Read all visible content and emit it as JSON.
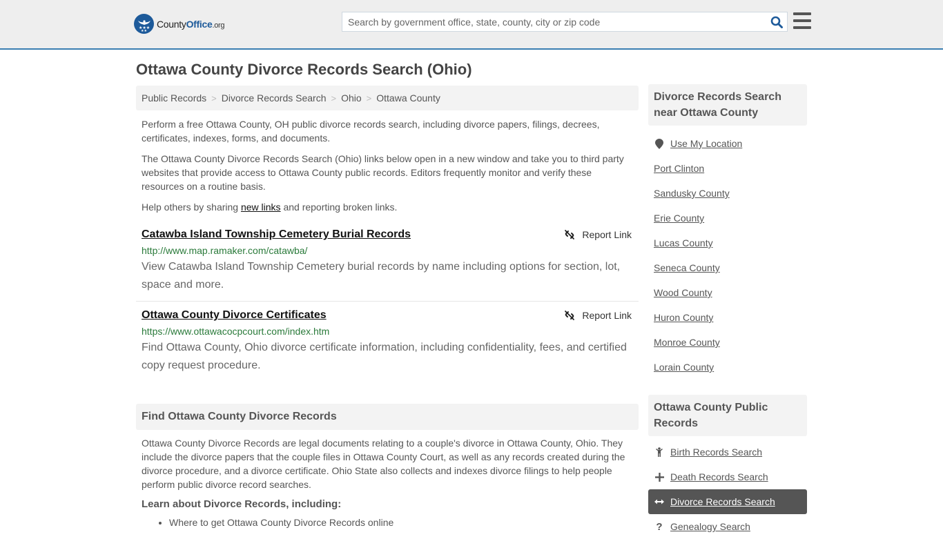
{
  "header": {
    "logo": {
      "county": "County",
      "office": "Office",
      "org": ".org"
    },
    "search": {
      "placeholder": "Search by government office, state, county, city or zip code",
      "value": ""
    },
    "brand_color": "#1d5a9a",
    "accent_border": "#3a7eb1"
  },
  "page": {
    "title": "Ottawa County Divorce Records Search (Ohio)"
  },
  "breadcrumb": [
    {
      "label": "Public Records"
    },
    {
      "label": "Divorce Records Search"
    },
    {
      "label": "Ohio"
    },
    {
      "label": "Ottawa County"
    }
  ],
  "breadcrumb_sep": ">",
  "intro": {
    "p1": "Perform a free Ottawa County, OH public divorce records search, including divorce papers, filings, decrees, certificates, indexes, forms, and documents.",
    "p2": "The Ottawa County Divorce Records Search (Ohio) links below open in a new window and take you to third party websites that provide access to Ottawa County public records. Editors frequently monitor and verify these resources on a routine basis.",
    "p3_before": "Help others by sharing ",
    "p3_link": "new links",
    "p3_after": " and reporting broken links."
  },
  "links": [
    {
      "title": "Catawba Island Township Cemetery Burial Records",
      "url": "http://www.map.ramaker.com/catawba/",
      "description": "View Catawba Island Township Cemetery burial records by name including options for section, lot, space and more.",
      "report_label": "Report Link"
    },
    {
      "title": "Ottawa County Divorce Certificates",
      "url": "https://www.ottawacocpcourt.com/index.htm",
      "description": "Find Ottawa County, Ohio divorce certificate information, including confidentiality, fees, and certified copy request procedure.",
      "report_label": "Report Link"
    }
  ],
  "find_section": {
    "heading": "Find Ottawa County Divorce Records",
    "body": "Ottawa County Divorce Records are legal documents relating to a couple's divorce in Ottawa County, Ohio. They include the divorce papers that the couple files in Ottawa County Court, as well as any records created during the divorce procedure, and a divorce certificate. Ohio State also collects and indexes divorce filings to help people perform public divorce record searches.",
    "learn_heading": "Learn about Divorce Records, including:",
    "bullets": [
      "Where to get Ottawa County Divorce Records online"
    ]
  },
  "sidebar": {
    "nearby": {
      "heading": "Divorce Records Search near Ottawa County",
      "use_location": "Use My Location",
      "items": [
        {
          "label": "Port Clinton"
        },
        {
          "label": "Sandusky County"
        },
        {
          "label": "Erie County"
        },
        {
          "label": "Lucas County"
        },
        {
          "label": "Seneca County"
        },
        {
          "label": "Wood County"
        },
        {
          "label": "Huron County"
        },
        {
          "label": "Monroe County"
        },
        {
          "label": "Lorain County"
        }
      ]
    },
    "public_records": {
      "heading": "Ottawa County Public Records",
      "items": [
        {
          "label": "Birth Records Search",
          "icon": "child-icon"
        },
        {
          "label": "Death Records Search",
          "icon": "plus-icon"
        },
        {
          "label": "Divorce Records Search",
          "icon": "arrows-horizontal-icon",
          "active": true
        },
        {
          "label": "Genealogy Search",
          "icon": "question-icon"
        }
      ]
    }
  }
}
